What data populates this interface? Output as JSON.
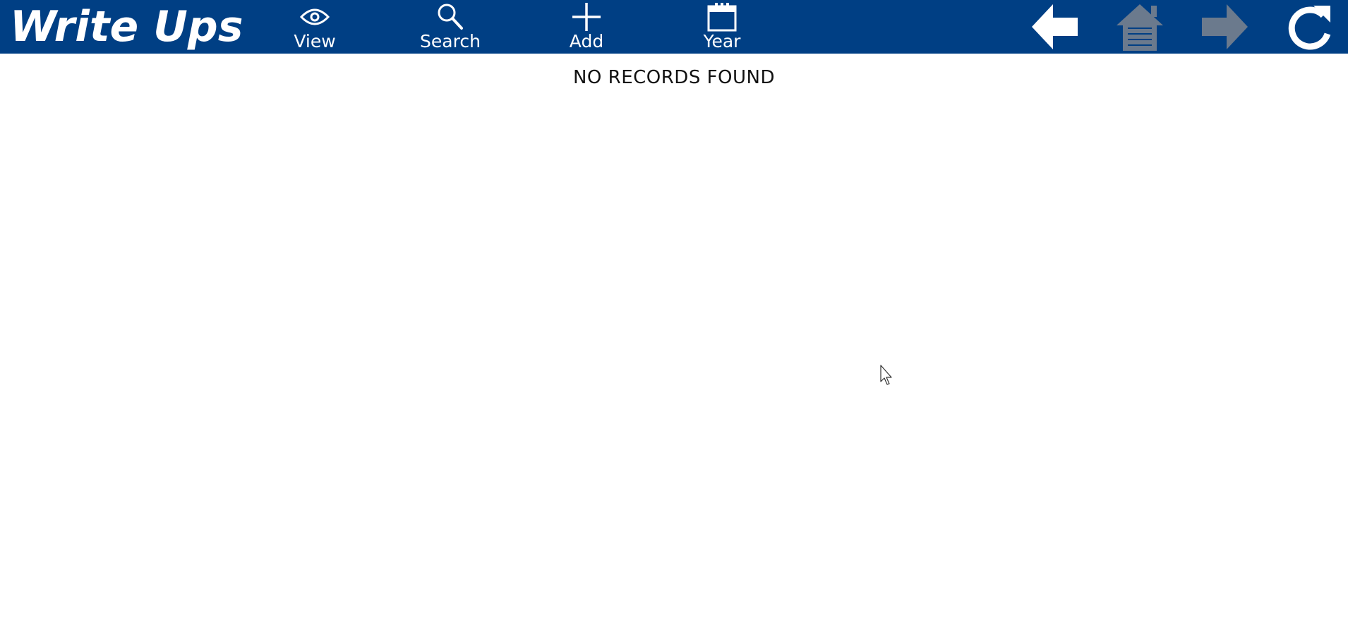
{
  "app": {
    "title": "Write Ups"
  },
  "toolbar": {
    "items": [
      {
        "label": "View",
        "icon": "eye-icon"
      },
      {
        "label": "Search",
        "icon": "magnifier-icon"
      },
      {
        "label": "Add",
        "icon": "plus-icon"
      },
      {
        "label": "Year",
        "icon": "calendar-icon"
      }
    ]
  },
  "nav": {
    "back_icon": "arrow-left-icon",
    "home_icon": "home-icon",
    "forward_icon": "arrow-right-icon",
    "refresh_icon": "refresh-icon",
    "home_enabled": false,
    "forward_enabled": false
  },
  "main": {
    "empty_message": "NO RECORDS FOUND"
  },
  "colors": {
    "header_bg": "#003f84",
    "header_fg": "#ffffff",
    "disabled_icon": "#6b7a8d"
  }
}
